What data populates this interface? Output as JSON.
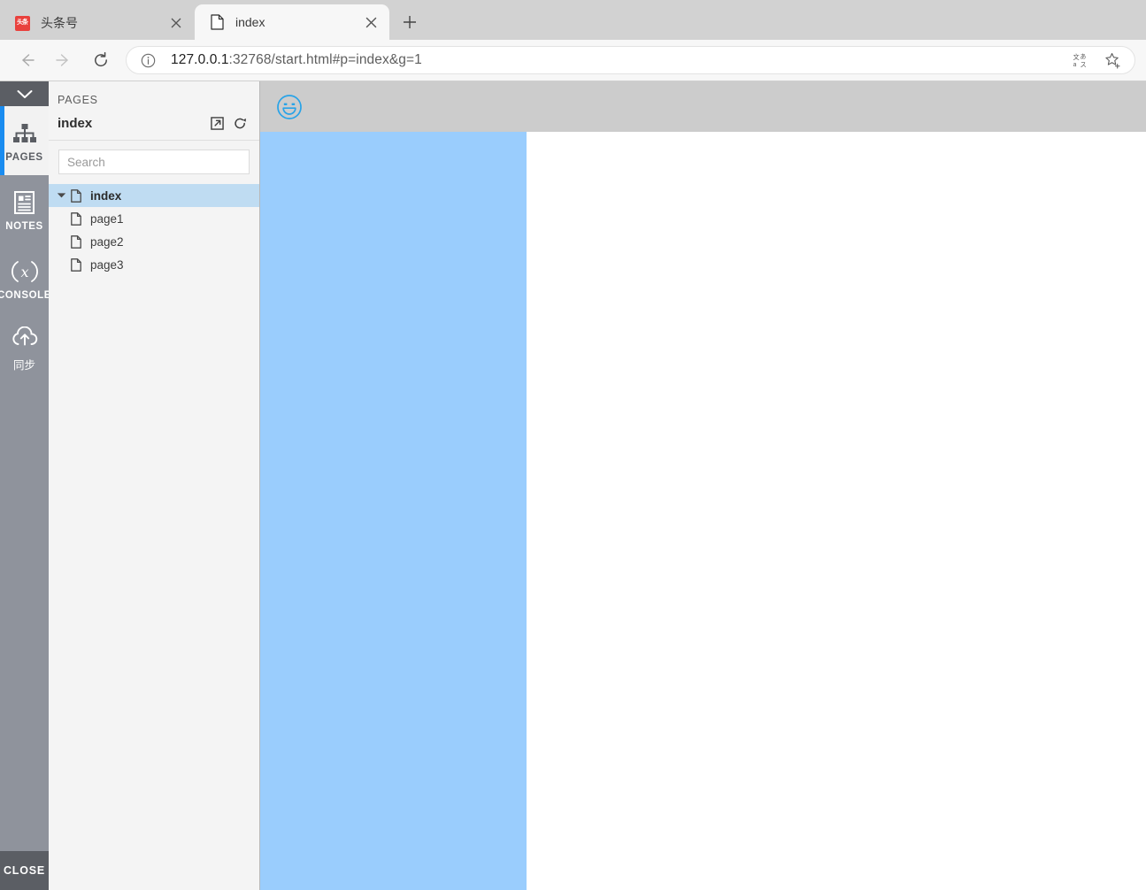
{
  "browser": {
    "tabs": [
      {
        "title": "头条号",
        "favicon": "toutiao-favicon",
        "favicon_text": "头条",
        "active": false
      },
      {
        "title": "index",
        "favicon": "document-icon",
        "favicon_text": "",
        "active": true
      }
    ],
    "new_tab_label": "+",
    "nav": {
      "back_label": "←",
      "forward_label": "→",
      "reload_label": "⟳"
    },
    "omnibox": {
      "info_icon": "site-info-icon",
      "url_host": "127.0.0.1",
      "url_rest": ":32768/start.html#p=index&g=1",
      "url_full": "127.0.0.1:32768/start.html#p=index&g=1",
      "actions": [
        {
          "icon": "translate-icon"
        },
        {
          "icon": "bookmark-star-icon"
        }
      ]
    }
  },
  "rail": {
    "collapse_icon": "chevron-down-icon",
    "items": [
      {
        "label": "PAGES",
        "icon": "sitemap-icon",
        "active": true,
        "cjk": false
      },
      {
        "label": "NOTES",
        "icon": "note-icon",
        "active": false,
        "cjk": false
      },
      {
        "label": "CONSOLE",
        "icon": "variable-x-icon",
        "active": false,
        "cjk": false
      },
      {
        "label": "同步",
        "icon": "cloud-upload-icon",
        "active": false,
        "cjk": true
      }
    ],
    "close_label": "CLOSE"
  },
  "panel": {
    "kicker": "PAGES",
    "title": "index",
    "actions": [
      {
        "icon": "external-link-icon"
      },
      {
        "icon": "refresh-icon"
      }
    ],
    "search": {
      "placeholder": "Search",
      "value": ""
    },
    "tree": [
      {
        "label": "index",
        "icon": "document-icon",
        "twisty": "▾",
        "selected": true,
        "child": false
      },
      {
        "label": "page1",
        "icon": "document-icon",
        "twisty": "",
        "selected": false,
        "child": true
      },
      {
        "label": "page2",
        "icon": "document-icon",
        "twisty": "",
        "selected": false,
        "child": true
      },
      {
        "label": "page3",
        "icon": "document-icon",
        "twisty": "",
        "selected": false,
        "child": true
      }
    ]
  },
  "canvas": {
    "toolbar": {
      "smiley_icon": "smiley-face-icon"
    },
    "colors": {
      "toolbar_bg": "#cccccc",
      "blue_pane": "#9acdfd",
      "white_pane": "#ffffff",
      "accent": "#1a8cf0",
      "smiley": "#28a3e8"
    }
  }
}
